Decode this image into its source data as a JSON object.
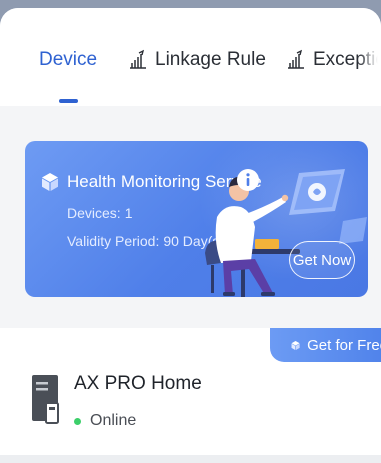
{
  "tabs": {
    "device": "Device",
    "linkage_rule": "Linkage Rule",
    "exception": "Exceptio"
  },
  "banner": {
    "title": "Health Monitoring Service",
    "devices_label": "Devices:",
    "devices_value": "1",
    "validity_label": "Validity Period:",
    "validity_value": "90 Day(s)",
    "button": "Get Now"
  },
  "device": {
    "badge": "Get for Free",
    "name": "AX PRO Home",
    "status": "Online"
  },
  "colors": {
    "accent": "#2f62d1",
    "banner": "#5583ea",
    "online": "#3ccf6a"
  },
  "icons": {
    "tab_linkage": "linkage-rule-icon",
    "tab_exception": "exception-icon",
    "banner": "cube-icon",
    "info": "info-icon",
    "badge": "cube-icon",
    "device": "alarm-hub-icon"
  }
}
